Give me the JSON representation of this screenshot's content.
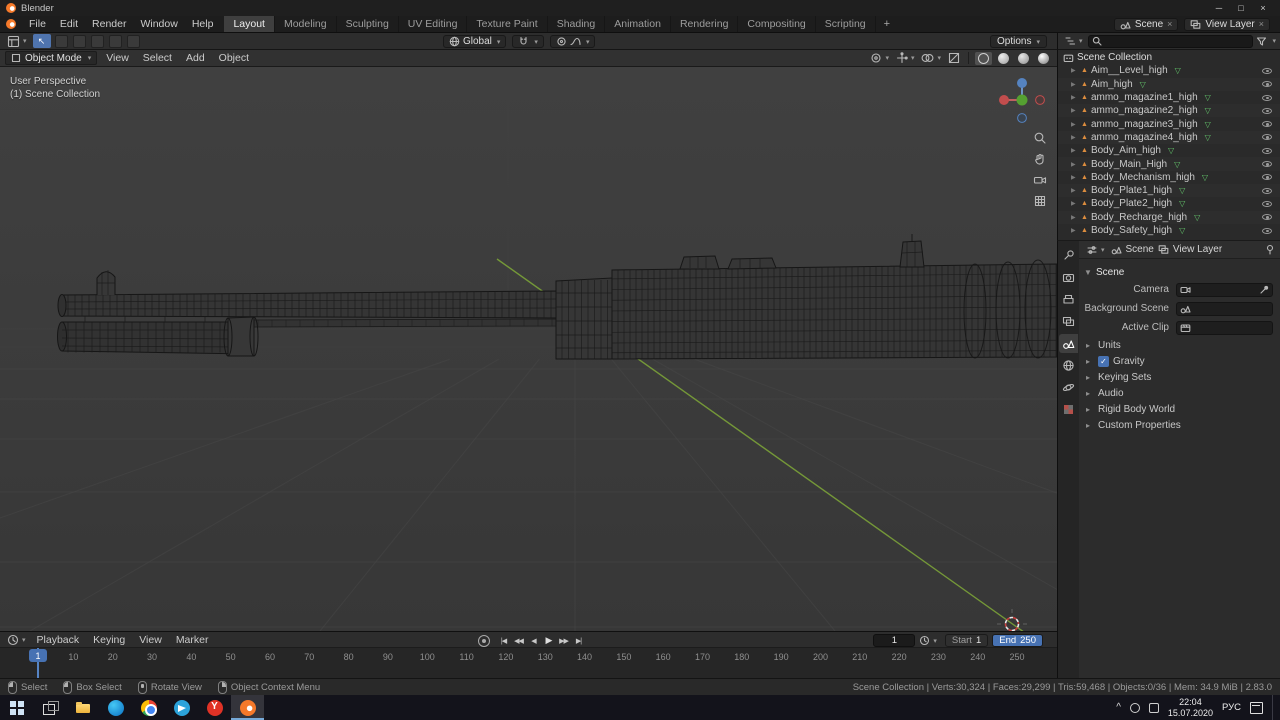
{
  "titlebar": {
    "app": "Blender",
    "minimize": "─",
    "maximize": "□",
    "close": "×"
  },
  "topbar": {
    "menus": [
      "File",
      "Edit",
      "Render",
      "Window",
      "Help"
    ],
    "workspaces": [
      "Layout",
      "Modeling",
      "Sculpting",
      "UV Editing",
      "Texture Paint",
      "Shading",
      "Animation",
      "Rendering",
      "Compositing",
      "Scripting"
    ],
    "active_workspace": "Layout",
    "add_workspace": "+",
    "scene": "Scene",
    "view_layer": "View Layer"
  },
  "toolbar": {
    "orientation": "Global",
    "options": "Options"
  },
  "viewport": {
    "mode": "Object Mode",
    "menus": [
      "View",
      "Select",
      "Add",
      "Object"
    ],
    "overlay": [
      "User Perspective",
      "(1) Scene Collection"
    ]
  },
  "outliner": {
    "root": "Scene Collection",
    "search_placeholder": "",
    "items": [
      "Aim__Level_high",
      "Aim_high",
      "ammo_magazine1_high",
      "ammo_magazine2_high",
      "ammo_magazine3_high",
      "ammo_magazine4_high",
      "Body_Aim_high",
      "Body_Main_High",
      "Body_Mechanism_high",
      "Body_Plate1_high",
      "Body_Plate2_high",
      "Body_Recharge_high",
      "Body_Safety_high"
    ]
  },
  "properties": {
    "breadcrumb_scene": "Scene",
    "breadcrumb_view_layer": "View Layer",
    "section": "Scene",
    "fields": [
      {
        "label": "Camera"
      },
      {
        "label": "Background Scene"
      },
      {
        "label": "Active Clip"
      }
    ],
    "panels": [
      {
        "label": "Units"
      },
      {
        "label": "Gravity",
        "checkbox": true
      },
      {
        "label": "Keying Sets"
      },
      {
        "label": "Audio"
      },
      {
        "label": "Rigid Body World"
      },
      {
        "label": "Custom Properties"
      }
    ]
  },
  "timeline": {
    "menus": [
      "Playback",
      "Keying",
      "View",
      "Marker"
    ],
    "buttons": [
      {
        "name": "jump-to-start",
        "glyph": "|◀"
      },
      {
        "name": "previous-keyframe",
        "glyph": "◀◀"
      },
      {
        "name": "play-reverse",
        "glyph": "◀"
      },
      {
        "name": "play",
        "glyph": "▶"
      },
      {
        "name": "next-keyframe",
        "glyph": "▶▶"
      },
      {
        "name": "jump-to-end",
        "glyph": "▶|"
      }
    ],
    "current_frame": "1",
    "start_label": "Start",
    "start_value": "1",
    "end_label": "End",
    "end_value": "250",
    "ticks": [
      10,
      20,
      30,
      40,
      50,
      60,
      70,
      80,
      90,
      100,
      110,
      120,
      130,
      140,
      150,
      160,
      170,
      180,
      190,
      200,
      210,
      220,
      230,
      240,
      250
    ]
  },
  "statusbar": {
    "hints": [
      {
        "button": "left",
        "label": "Select"
      },
      {
        "button": "left",
        "label": "Box Select"
      },
      {
        "button": "middle",
        "label": "Rotate View"
      },
      {
        "button": "right",
        "label": "Object Context Menu"
      }
    ],
    "stats": "Scene Collection | Verts:30,324 | Faces:29,299 | Tris:59,468 | Objects:0/36 | Mem: 34.9 MiB | 2.83.0"
  },
  "taskbar": {
    "icons": [
      {
        "name": "start"
      },
      {
        "name": "task-view"
      },
      {
        "name": "file-explorer"
      },
      {
        "name": "edge"
      },
      {
        "name": "chrome"
      },
      {
        "name": "telegram"
      },
      {
        "name": "yandex-browser"
      },
      {
        "name": "blender",
        "active": true
      }
    ],
    "tray_chevron": "^",
    "language": "РУС",
    "time": "22:04",
    "date": "15.07.2020"
  },
  "icons": {
    "caret": "▾",
    "expand": "▶",
    "collapse": "▼",
    "panel_closed": "▸",
    "object": "▲",
    "mesh_data": "▽",
    "check": "✓",
    "unlink": "×",
    "cursor_tool": "↖"
  },
  "colors": {
    "accent": "#4772b3",
    "object_orange": "#dd8d3e",
    "mesh_green": "#62c36a",
    "axis_y_green": "#7ba238"
  }
}
